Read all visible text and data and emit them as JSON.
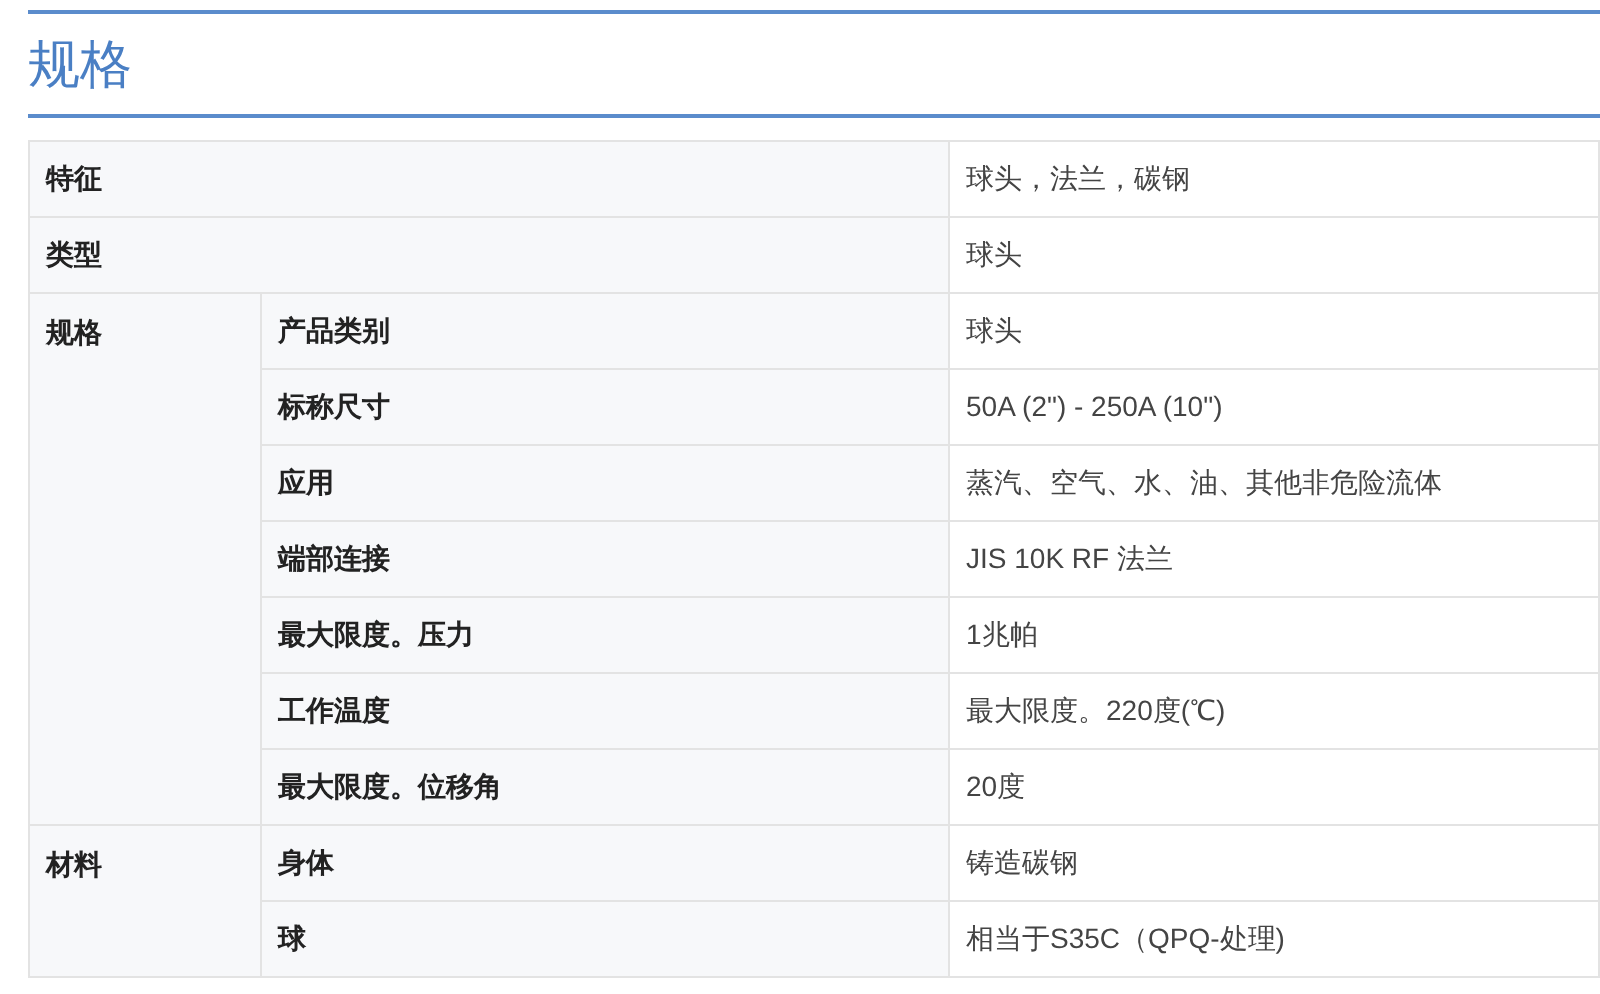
{
  "title": "规格",
  "groups": [
    {
      "label": "特征",
      "value": "球头，法兰，碳钢"
    },
    {
      "label": "类型",
      "value": "球头"
    },
    {
      "label": "规格",
      "rows": [
        {
          "label": "产品类别",
          "value": "球头"
        },
        {
          "label": "标称尺寸",
          "value": "50A (2\") - 250A (10\")"
        },
        {
          "label": "应用",
          "value": "蒸汽、空气、水、油、其他非危险流体"
        },
        {
          "label": "端部连接",
          "value": "JIS 10K RF 法兰"
        },
        {
          "label": "最大限度。压力",
          "value": "1兆帕"
        },
        {
          "label": "工作温度",
          "value": "最大限度。220度(℃)"
        },
        {
          "label": "最大限度。位移角",
          "value": "20度"
        }
      ]
    },
    {
      "label": "材料",
      "rows": [
        {
          "label": "身体",
          "value": "铸造碳钢"
        },
        {
          "label": "球",
          "value": "相当于S35C（QPQ-处理)"
        }
      ]
    }
  ]
}
